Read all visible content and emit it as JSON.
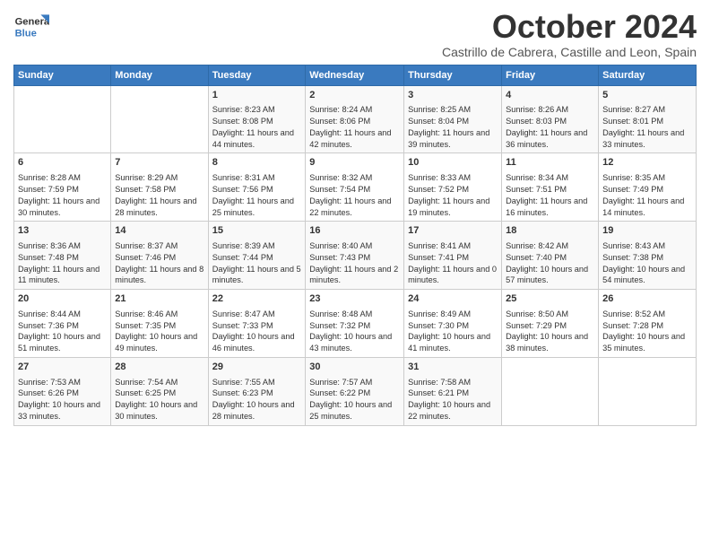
{
  "header": {
    "logo_general": "General",
    "logo_blue": "Blue",
    "month": "October 2024",
    "location": "Castrillo de Cabrera, Castille and Leon, Spain"
  },
  "weekdays": [
    "Sunday",
    "Monday",
    "Tuesday",
    "Wednesday",
    "Thursday",
    "Friday",
    "Saturday"
  ],
  "weeks": [
    [
      {
        "day": "",
        "info": ""
      },
      {
        "day": "",
        "info": ""
      },
      {
        "day": "1",
        "info": "Sunrise: 8:23 AM\nSunset: 8:08 PM\nDaylight: 11 hours and 44 minutes."
      },
      {
        "day": "2",
        "info": "Sunrise: 8:24 AM\nSunset: 8:06 PM\nDaylight: 11 hours and 42 minutes."
      },
      {
        "day": "3",
        "info": "Sunrise: 8:25 AM\nSunset: 8:04 PM\nDaylight: 11 hours and 39 minutes."
      },
      {
        "day": "4",
        "info": "Sunrise: 8:26 AM\nSunset: 8:03 PM\nDaylight: 11 hours and 36 minutes."
      },
      {
        "day": "5",
        "info": "Sunrise: 8:27 AM\nSunset: 8:01 PM\nDaylight: 11 hours and 33 minutes."
      }
    ],
    [
      {
        "day": "6",
        "info": "Sunrise: 8:28 AM\nSunset: 7:59 PM\nDaylight: 11 hours and 30 minutes."
      },
      {
        "day": "7",
        "info": "Sunrise: 8:29 AM\nSunset: 7:58 PM\nDaylight: 11 hours and 28 minutes."
      },
      {
        "day": "8",
        "info": "Sunrise: 8:31 AM\nSunset: 7:56 PM\nDaylight: 11 hours and 25 minutes."
      },
      {
        "day": "9",
        "info": "Sunrise: 8:32 AM\nSunset: 7:54 PM\nDaylight: 11 hours and 22 minutes."
      },
      {
        "day": "10",
        "info": "Sunrise: 8:33 AM\nSunset: 7:52 PM\nDaylight: 11 hours and 19 minutes."
      },
      {
        "day": "11",
        "info": "Sunrise: 8:34 AM\nSunset: 7:51 PM\nDaylight: 11 hours and 16 minutes."
      },
      {
        "day": "12",
        "info": "Sunrise: 8:35 AM\nSunset: 7:49 PM\nDaylight: 11 hours and 14 minutes."
      }
    ],
    [
      {
        "day": "13",
        "info": "Sunrise: 8:36 AM\nSunset: 7:48 PM\nDaylight: 11 hours and 11 minutes."
      },
      {
        "day": "14",
        "info": "Sunrise: 8:37 AM\nSunset: 7:46 PM\nDaylight: 11 hours and 8 minutes."
      },
      {
        "day": "15",
        "info": "Sunrise: 8:39 AM\nSunset: 7:44 PM\nDaylight: 11 hours and 5 minutes."
      },
      {
        "day": "16",
        "info": "Sunrise: 8:40 AM\nSunset: 7:43 PM\nDaylight: 11 hours and 2 minutes."
      },
      {
        "day": "17",
        "info": "Sunrise: 8:41 AM\nSunset: 7:41 PM\nDaylight: 11 hours and 0 minutes."
      },
      {
        "day": "18",
        "info": "Sunrise: 8:42 AM\nSunset: 7:40 PM\nDaylight: 10 hours and 57 minutes."
      },
      {
        "day": "19",
        "info": "Sunrise: 8:43 AM\nSunset: 7:38 PM\nDaylight: 10 hours and 54 minutes."
      }
    ],
    [
      {
        "day": "20",
        "info": "Sunrise: 8:44 AM\nSunset: 7:36 PM\nDaylight: 10 hours and 51 minutes."
      },
      {
        "day": "21",
        "info": "Sunrise: 8:46 AM\nSunset: 7:35 PM\nDaylight: 10 hours and 49 minutes."
      },
      {
        "day": "22",
        "info": "Sunrise: 8:47 AM\nSunset: 7:33 PM\nDaylight: 10 hours and 46 minutes."
      },
      {
        "day": "23",
        "info": "Sunrise: 8:48 AM\nSunset: 7:32 PM\nDaylight: 10 hours and 43 minutes."
      },
      {
        "day": "24",
        "info": "Sunrise: 8:49 AM\nSunset: 7:30 PM\nDaylight: 10 hours and 41 minutes."
      },
      {
        "day": "25",
        "info": "Sunrise: 8:50 AM\nSunset: 7:29 PM\nDaylight: 10 hours and 38 minutes."
      },
      {
        "day": "26",
        "info": "Sunrise: 8:52 AM\nSunset: 7:28 PM\nDaylight: 10 hours and 35 minutes."
      }
    ],
    [
      {
        "day": "27",
        "info": "Sunrise: 7:53 AM\nSunset: 6:26 PM\nDaylight: 10 hours and 33 minutes."
      },
      {
        "day": "28",
        "info": "Sunrise: 7:54 AM\nSunset: 6:25 PM\nDaylight: 10 hours and 30 minutes."
      },
      {
        "day": "29",
        "info": "Sunrise: 7:55 AM\nSunset: 6:23 PM\nDaylight: 10 hours and 28 minutes."
      },
      {
        "day": "30",
        "info": "Sunrise: 7:57 AM\nSunset: 6:22 PM\nDaylight: 10 hours and 25 minutes."
      },
      {
        "day": "31",
        "info": "Sunrise: 7:58 AM\nSunset: 6:21 PM\nDaylight: 10 hours and 22 minutes."
      },
      {
        "day": "",
        "info": ""
      },
      {
        "day": "",
        "info": ""
      }
    ]
  ]
}
